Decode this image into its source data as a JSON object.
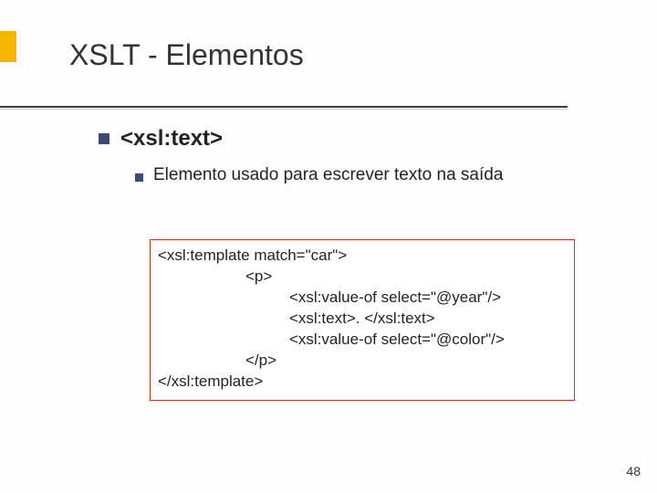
{
  "title": "XSLT - Elementos",
  "heading": "<xsl:text>",
  "description": "Elemento usado para escrever texto na saída",
  "code": {
    "l1": "<xsl:template match=\"car\">",
    "l2": "<p>",
    "l3": "<xsl:value-of select=\"@year\"/>",
    "l4": "<xsl:text>. </xsl:text>",
    "l5": "<xsl:value-of select=\"@color\"/>",
    "l6": "</p>",
    "l7": "</xsl:template>"
  },
  "page_number": "48"
}
